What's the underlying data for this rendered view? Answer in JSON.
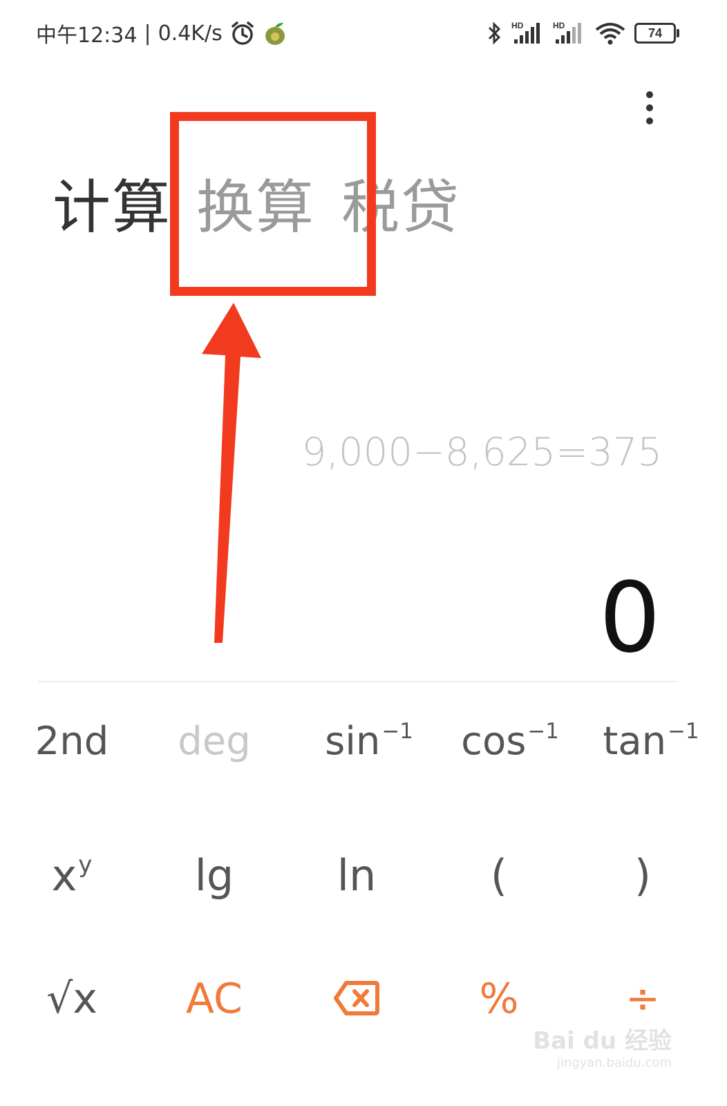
{
  "status_bar": {
    "time": "中午12:34",
    "separator": "|",
    "net_speed": "0.4K/s",
    "battery": "74",
    "icons": [
      "alarm-icon",
      "app-notification-icon",
      "bluetooth-icon",
      "hd-signal-icon",
      "hd-signal-icon",
      "wifi-icon",
      "battery-icon"
    ]
  },
  "tabs": [
    {
      "label": "计算",
      "active": true
    },
    {
      "label": "换算",
      "active": false
    },
    {
      "label": "税贷",
      "active": false
    }
  ],
  "display": {
    "expression": "9,000−8,625=375",
    "result": "0"
  },
  "keypad": {
    "row1": {
      "second": "2nd",
      "deg": "deg",
      "sin": "sin",
      "cos": "cos",
      "tan": "tan",
      "inv": "−1"
    },
    "row2": {
      "x": "x",
      "y": "y",
      "lg": "lg",
      "ln": "ln",
      "lparen": "(",
      "rparen": ")"
    },
    "row3": {
      "sqrt": "√x",
      "ac": "AC",
      "percent": "%",
      "divide": "÷"
    }
  },
  "colors": {
    "accent": "#f07a3a",
    "annotation": "#f23a1e"
  },
  "watermark": {
    "main": "Bai du 经验",
    "sub": "jingyan.baidu.com"
  }
}
